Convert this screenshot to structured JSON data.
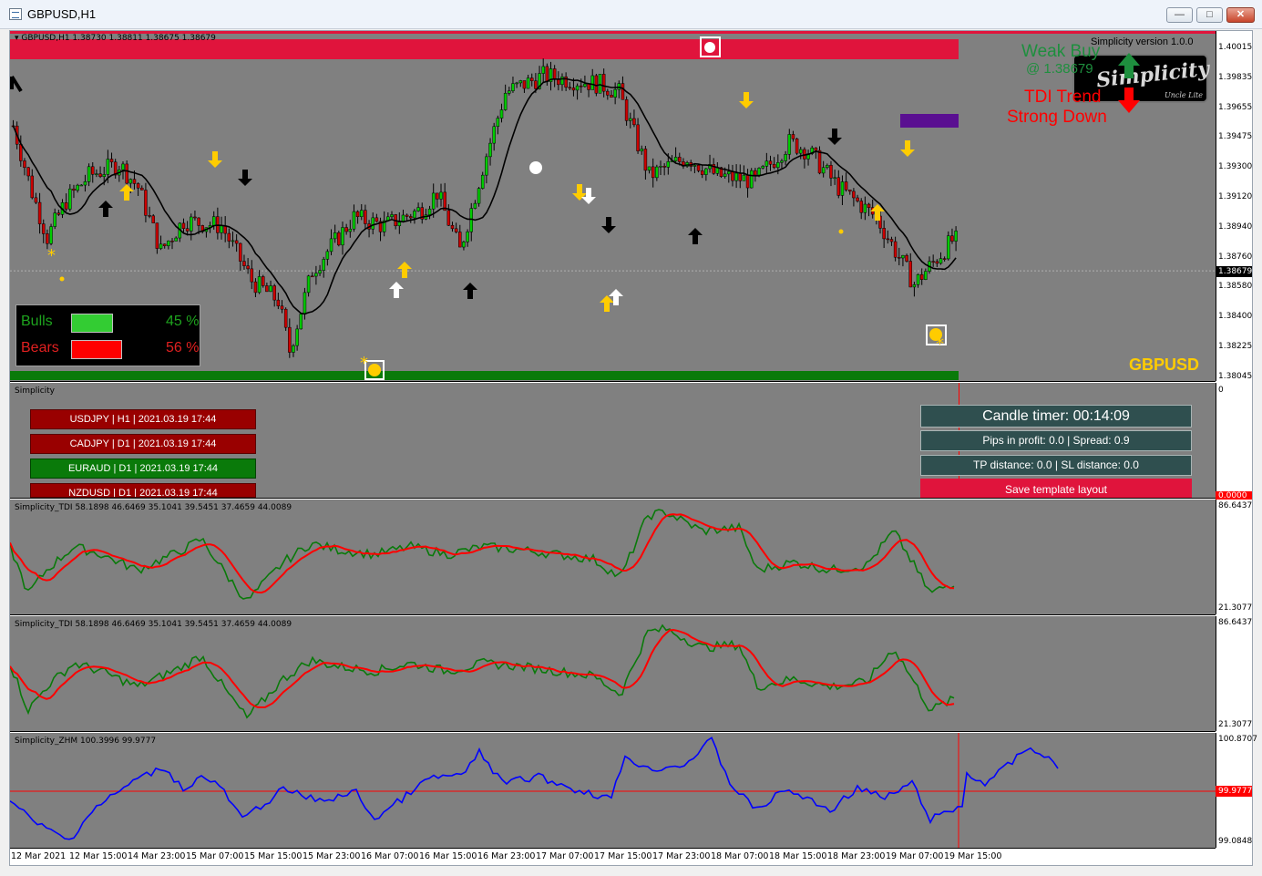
{
  "window": {
    "title": "GBPUSD,H1",
    "min_glyph": "—",
    "max_glyph": "□",
    "close_glyph": "✕"
  },
  "main_pane": {
    "header": "GBPUSD,H1  1.38730 1.38811 1.38675 1.38679",
    "symbol_label": "GBPUSD",
    "price_labels": [
      "1.40015",
      "1.39835",
      "1.39655",
      "1.39475",
      "1.39300",
      "1.39120",
      "1.38940",
      "1.38760",
      "1.38580",
      "1.38400",
      "1.38225",
      "1.38045"
    ],
    "current_price": "1.38679",
    "bulls": {
      "label": "Bulls",
      "percent_text": "45 %",
      "fraction": 0.45
    },
    "bears": {
      "label": "Bears",
      "percent_text": "56 %",
      "fraction": 0.56
    },
    "top_right": {
      "version": "Simplicity version 1.0.0",
      "logo_text": "Simplicity",
      "logo_sub": "Uncle Lite",
      "weak_buy": "Weak Buy",
      "weak_buy_price": "@ 1.38679",
      "tdi_trend": "TDI Trend",
      "tdi_strength": "Strong Down"
    },
    "colors": {
      "bull": "#00cc00",
      "bear": "#cc0000",
      "top_band": "#e0143c",
      "bottom_band": "#0a7a0a",
      "gold": "#ffcc00"
    }
  },
  "simplicity_pane": {
    "label": "Simplicity",
    "axis_top": "0",
    "axis_value": "0.0000",
    "signals": [
      {
        "text": "USDJPY | H1 | 2021.03.19 17:44",
        "state": "bear"
      },
      {
        "text": "CADJPY | D1 | 2021.03.19 17:44",
        "state": "bear"
      },
      {
        "text": "EURAUD | D1 | 2021.03.19 17:44",
        "state": "bull"
      },
      {
        "text": "NZDUSD | D1 | 2021.03.19 17:44",
        "state": "bear"
      }
    ],
    "candle_timer": "Candle timer: 00:14:09",
    "pips": "Pips in profit: 0.0 | Spread: 0.9",
    "tp_sl": "TP distance: 0.0 | SL distance: 0.0",
    "save_button": "Save template layout"
  },
  "tdi_pane_1": {
    "label": "Simplicity_TDI 58.1898 46.6469 35.1041 39.5451 37.4659 44.0089",
    "axis_top": "86.6437",
    "axis_bottom": "21.3077"
  },
  "tdi_pane_2": {
    "label": "Simplicity_TDI 58.1898 46.6469 35.1041 39.5451 37.4659 44.0089",
    "axis_top": "86.6437",
    "axis_bottom": "21.3077"
  },
  "zhm_pane": {
    "label": "Simplicity_ZHM 100.3996 99.9777",
    "axis_top": "100.8707",
    "axis_bottom": "99.0848",
    "axis_value": "99.9777"
  },
  "time_axis": [
    "12 Mar 2021",
    "12 Mar 15:00",
    "14 Mar 23:00",
    "15 Mar 07:00",
    "15 Mar 15:00",
    "15 Mar 23:00",
    "16 Mar 07:00",
    "16 Mar 15:00",
    "16 Mar 23:00",
    "17 Mar 07:00",
    "17 Mar 15:00",
    "17 Mar 23:00",
    "18 Mar 07:00",
    "18 Mar 15:00",
    "18 Mar 23:00",
    "19 Mar 07:00",
    "19 Mar 15:00"
  ]
}
